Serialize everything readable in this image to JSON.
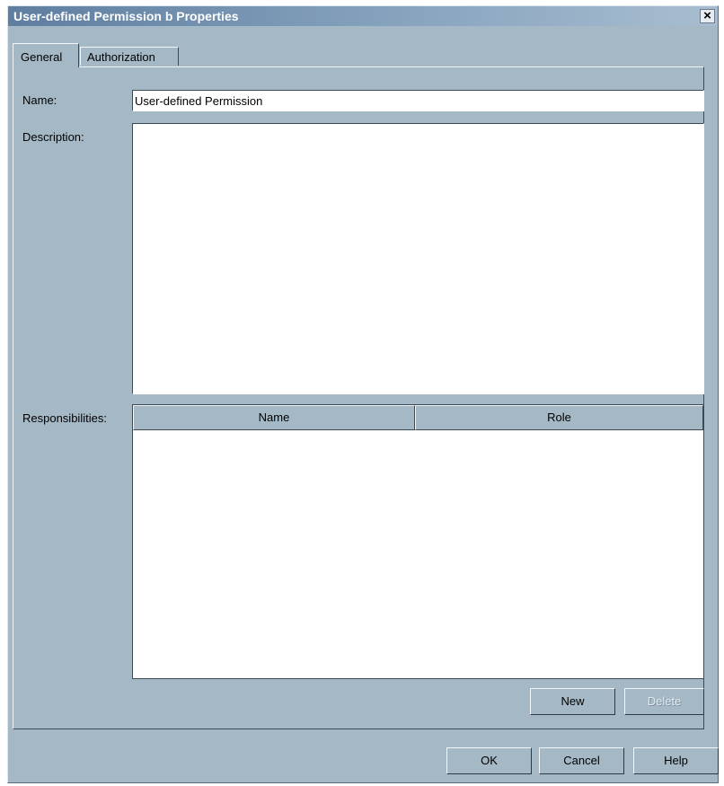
{
  "window": {
    "title": "User-defined Permission b Properties",
    "close_glyph": "×",
    "close_icon": "close-icon"
  },
  "tabs": [
    {
      "label": "General",
      "selected": true
    },
    {
      "label": "Authorization",
      "selected": false
    }
  ],
  "form": {
    "name_label": "Name:",
    "name_value": "User-defined Permission",
    "description_label": "Description:",
    "description_value": "",
    "responsibilities_label": "Responsibilities:"
  },
  "table": {
    "columns": [
      "Name",
      "Role"
    ],
    "rows": []
  },
  "table_buttons": {
    "new_label": "New",
    "delete_label": "Delete",
    "delete_disabled": true
  },
  "dialog_buttons": {
    "ok_label": "OK",
    "cancel_label": "Cancel",
    "help_label": "Help"
  },
  "colors": {
    "dialog_bg": "#a4b8c6",
    "titlebar": "#5f7ea0"
  }
}
